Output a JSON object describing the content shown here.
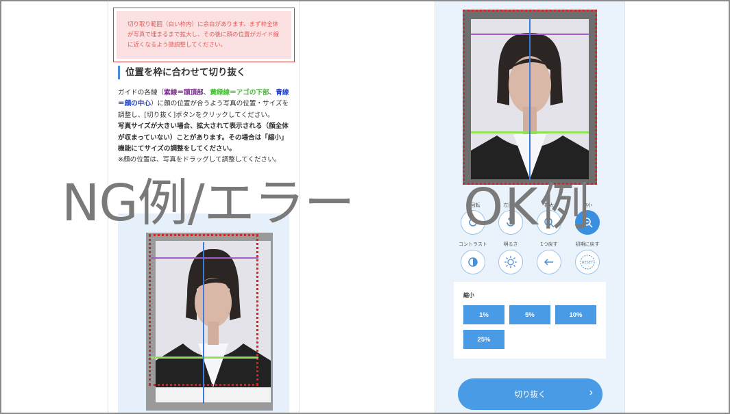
{
  "left": {
    "error_message": "切り取り範囲（白い枠内）に余白があります。まず枠全体が写真で埋まるまで拡大し、その後に顔の位置がガイド線に近くなるよう微調整してください。",
    "heading": "位置を枠に合わせて切り抜く",
    "p1": {
      "a": "ガイドの各線（",
      "purple": "紫線＝頭頂部",
      "b": "、",
      "green": "黄緑線＝アゴの下部",
      "c": "、",
      "blue": "青線＝顔の中心",
      "d": "）に顔の位置が合うよう写真の位置・サイズを調整し、[切り抜く]ボタンをクリックしてください。"
    },
    "p2": "写真サイズが大きい場合、拡大されて表示される（顔全体が収まっていない）ことがあります。その場合は「縮小」機能にてサイズの調整をしてください。",
    "p3": "※顔の位置は、写真をドラッグして調整してください。"
  },
  "right": {
    "tools_row1": [
      {
        "label": "右回転",
        "icon": "rotate-right-icon"
      },
      {
        "label": "左回転",
        "icon": "rotate-left-icon"
      },
      {
        "label": "拡大",
        "icon": "zoom-in-icon"
      },
      {
        "label": "縮小",
        "icon": "zoom-out-icon"
      }
    ],
    "tools_row2": [
      {
        "label": "コントラスト",
        "icon": "contrast-icon"
      },
      {
        "label": "明るさ",
        "icon": "brightness-icon"
      },
      {
        "label": "1つ戻す",
        "icon": "undo-arrow-icon"
      },
      {
        "label": "初期に戻す",
        "icon": "reset-icon",
        "text": "RESET"
      }
    ],
    "shrink_title": "縮小",
    "shrink_buttons": [
      "1%",
      "5%",
      "10%",
      "25%"
    ],
    "cut_button": "切り抜く",
    "cut_chevron": "›"
  },
  "overlay": {
    "ng_label": "NG例/エラー",
    "ok_label": "OK例"
  },
  "colors": {
    "guide_purple": "#a45cc7",
    "guide_green": "#8fe055",
    "guide_blue": "#3b7be0",
    "crop_border": "#c22b2b",
    "button_blue": "#4a9be6",
    "error_bg": "#fbe1e1",
    "error_text": "#e05b5b"
  }
}
